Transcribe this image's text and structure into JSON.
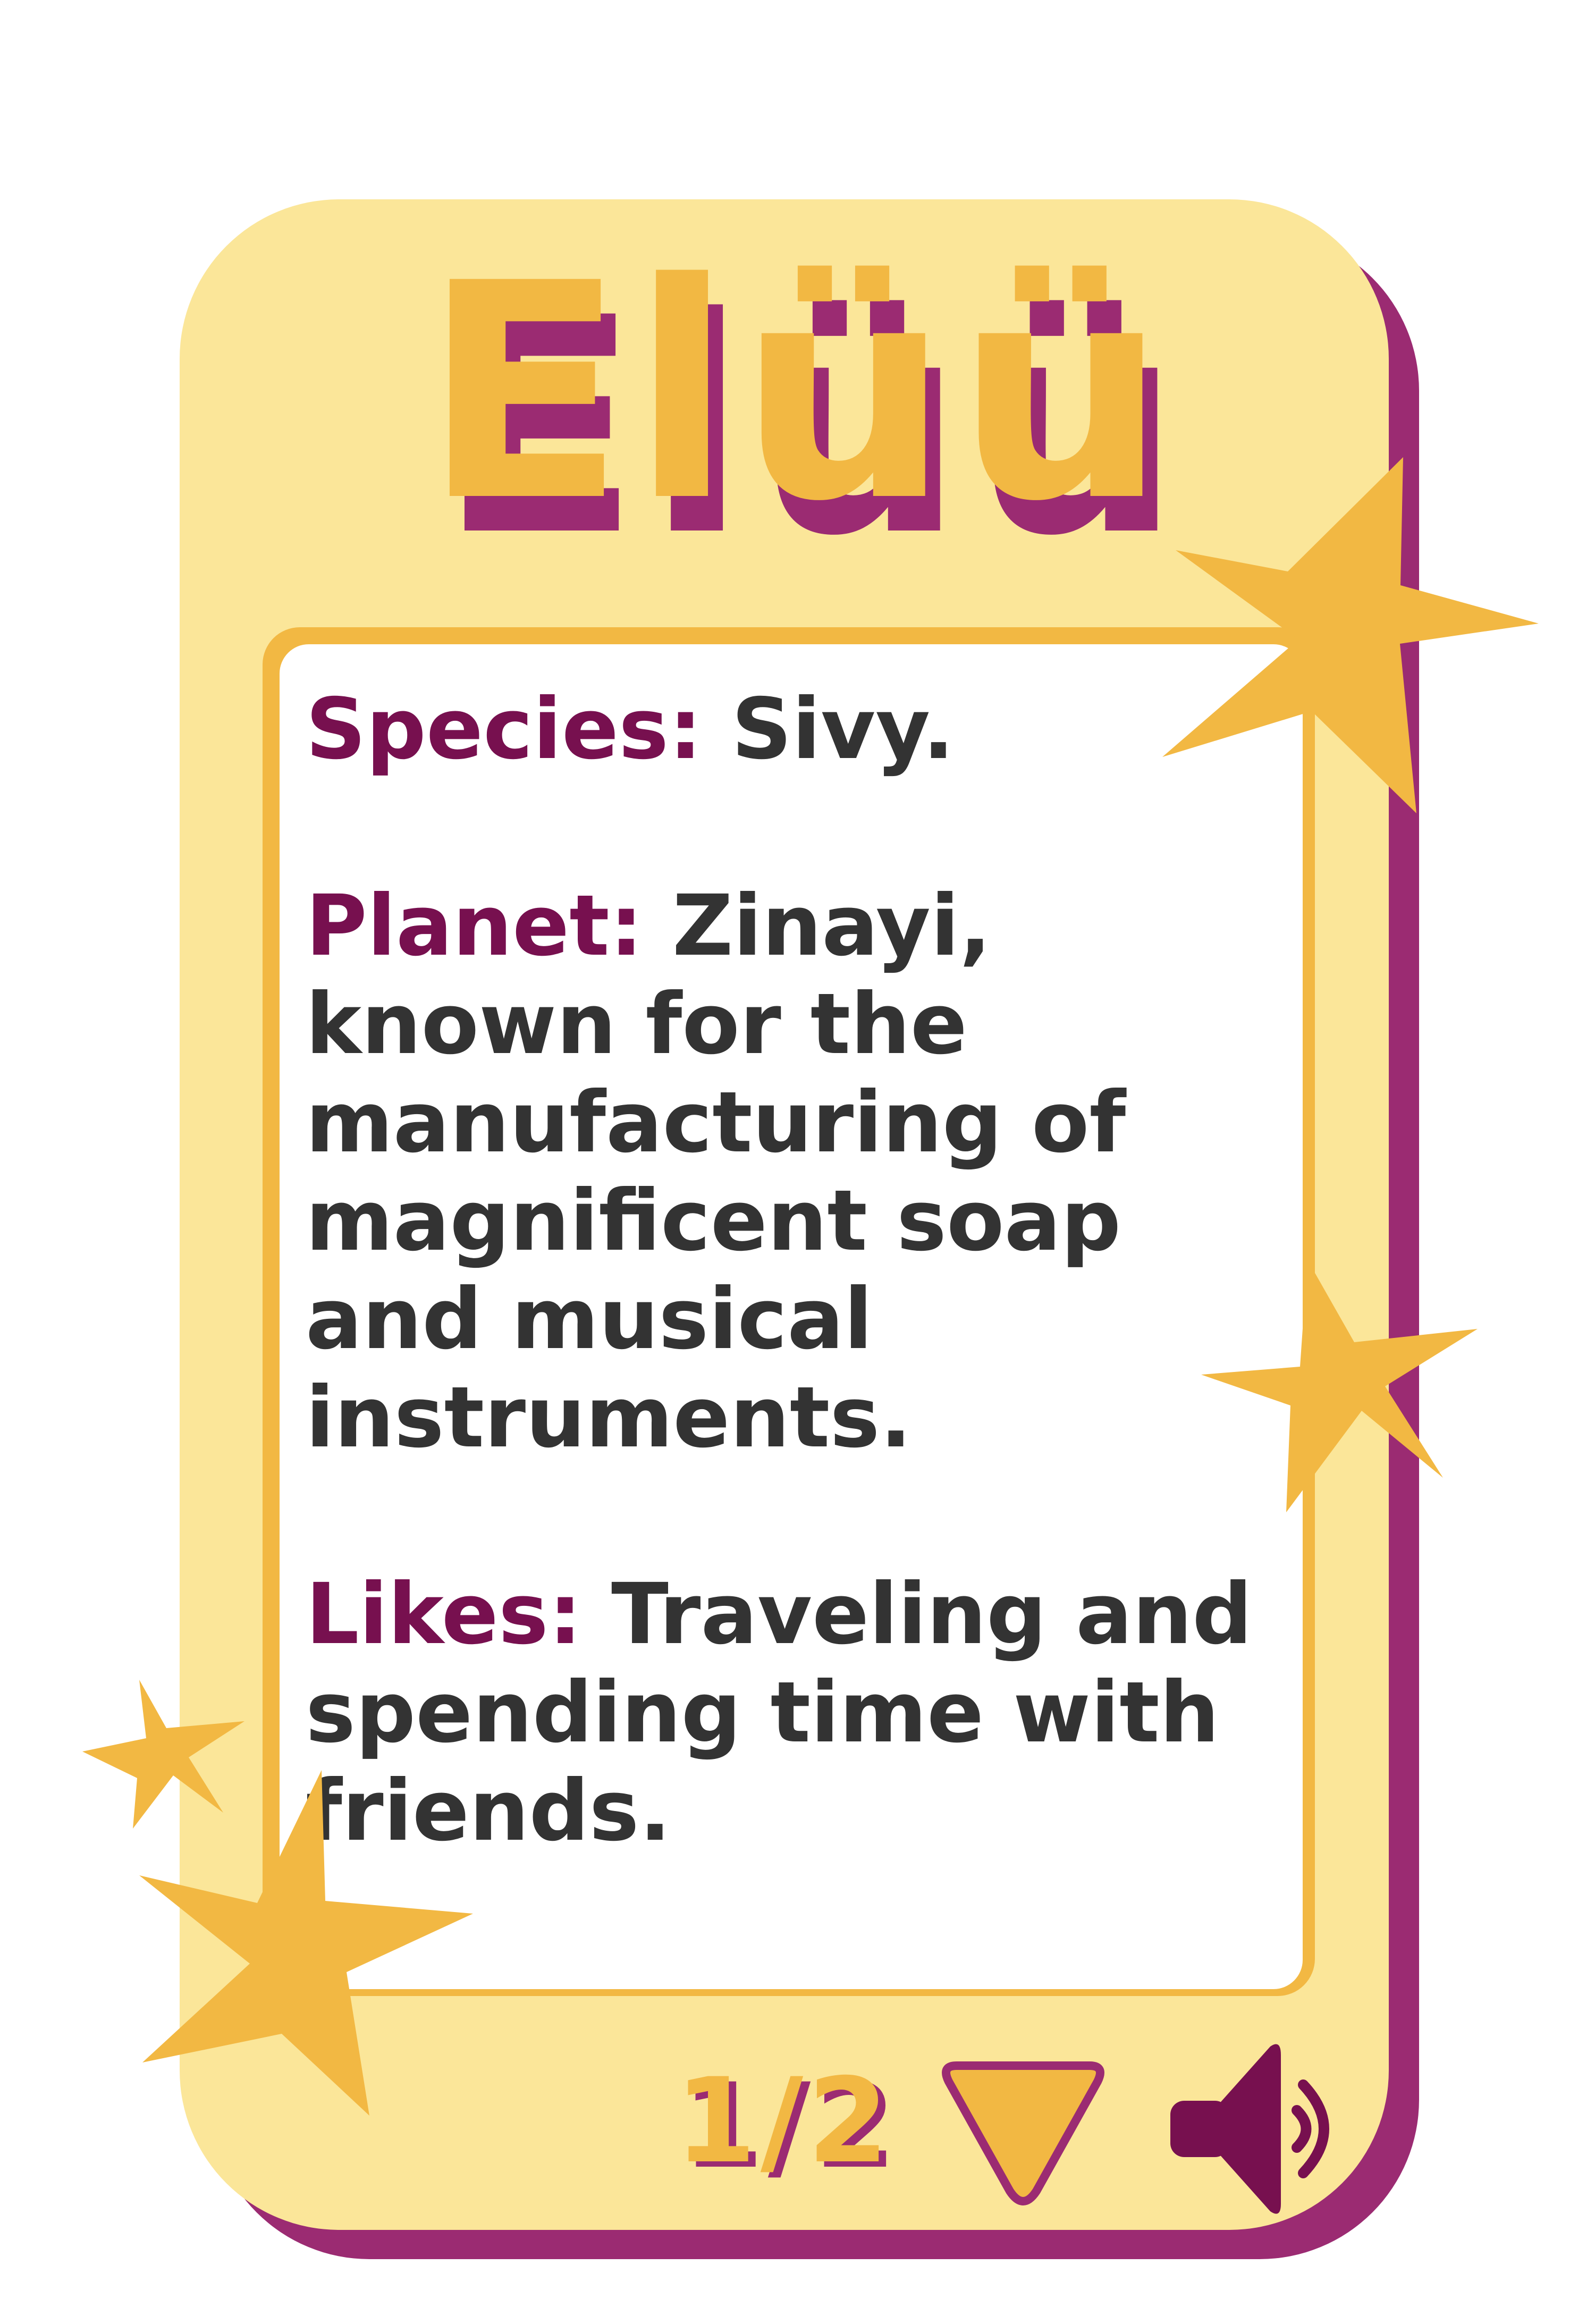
{
  "card": {
    "title": "Elüü",
    "fields": [
      {
        "label": "Species:",
        "value": "Sivy."
      },
      {
        "label": "Planet:",
        "value": "Zinayi, known for the manufacturing of magnificent soap and musical instruments."
      },
      {
        "label": "Likes:",
        "value": "Traveling and spending time with friends."
      }
    ],
    "pager": "1/2"
  },
  "controls": {
    "next_icon": "triangle-down-icon",
    "sound_icon": "speaker-icon"
  },
  "colors": {
    "card_fill": "#fbe699",
    "card_shadow": "#9b2b72",
    "accent_gold": "#f2b843",
    "label_purple": "#77104f",
    "text_dark": "#333333"
  }
}
